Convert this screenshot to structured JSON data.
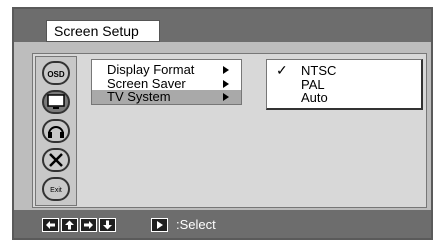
{
  "header": {
    "title": "Screen Setup"
  },
  "sidebar": {
    "icons": [
      {
        "name": "osd-icon",
        "label": "OSD"
      },
      {
        "name": "screen-icon",
        "active": true
      },
      {
        "name": "audio-icon"
      },
      {
        "name": "tools-icon"
      },
      {
        "name": "exit-icon",
        "label": "Exit"
      }
    ]
  },
  "menu": {
    "items": [
      {
        "label": "Display Format",
        "selected": false
      },
      {
        "label": "Screen Saver",
        "selected": false
      },
      {
        "label": "TV System",
        "selected": true
      }
    ]
  },
  "submenu": {
    "items": [
      {
        "label": "NTSC",
        "checked": true
      },
      {
        "label": "PAL",
        "checked": false
      },
      {
        "label": "Auto",
        "checked": false
      }
    ],
    "check_glyph": "✓"
  },
  "footer": {
    "nav_icons": [
      "left-arrow-icon",
      "up-arrow-icon",
      "right-arrow-icon",
      "down-arrow-icon",
      "play-icon"
    ],
    "select_label": ":Select"
  },
  "colors": {
    "background": "#bdbdbd",
    "bars": "#6d6d6d",
    "selected": "#a9a9a9"
  }
}
